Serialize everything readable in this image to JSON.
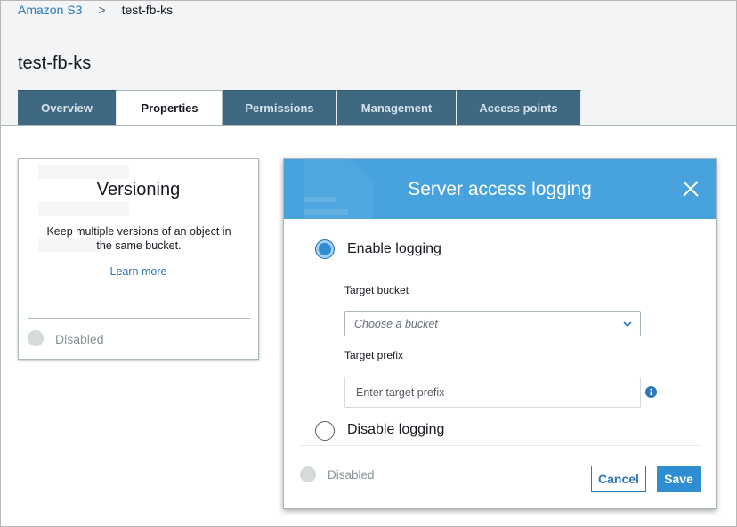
{
  "breadcrumb": {
    "root": "Amazon S3",
    "separator": ">",
    "current": "test-fb-ks"
  },
  "page": {
    "title": "test-fb-ks"
  },
  "tabs": [
    {
      "label": "Overview",
      "active": false
    },
    {
      "label": "Properties",
      "active": true
    },
    {
      "label": "Permissions",
      "active": false
    },
    {
      "label": "Management",
      "active": false
    },
    {
      "label": "Access points",
      "active": false
    }
  ],
  "versioning_card": {
    "title": "Versioning",
    "description": "Keep multiple versions of an object in the same bucket.",
    "learn_more": "Learn more",
    "status": "Disabled"
  },
  "modal": {
    "title": "Server access logging",
    "enable_option": "Enable logging",
    "enable_selected": true,
    "target_bucket_label": "Target bucket",
    "target_bucket_placeholder": "Choose a bucket",
    "target_prefix_label": "Target prefix",
    "target_prefix_placeholder": "Enter target prefix",
    "disable_option": "Disable logging",
    "status": "Disabled",
    "cancel_label": "Cancel",
    "save_label": "Save"
  },
  "colors": {
    "tab_bg": "#3f6883",
    "modal_header": "#48a2dd",
    "link": "#2c78b8",
    "primary": "#2e8ed1"
  },
  "icons": [
    "close-icon",
    "chevron-down-icon",
    "info-icon"
  ]
}
